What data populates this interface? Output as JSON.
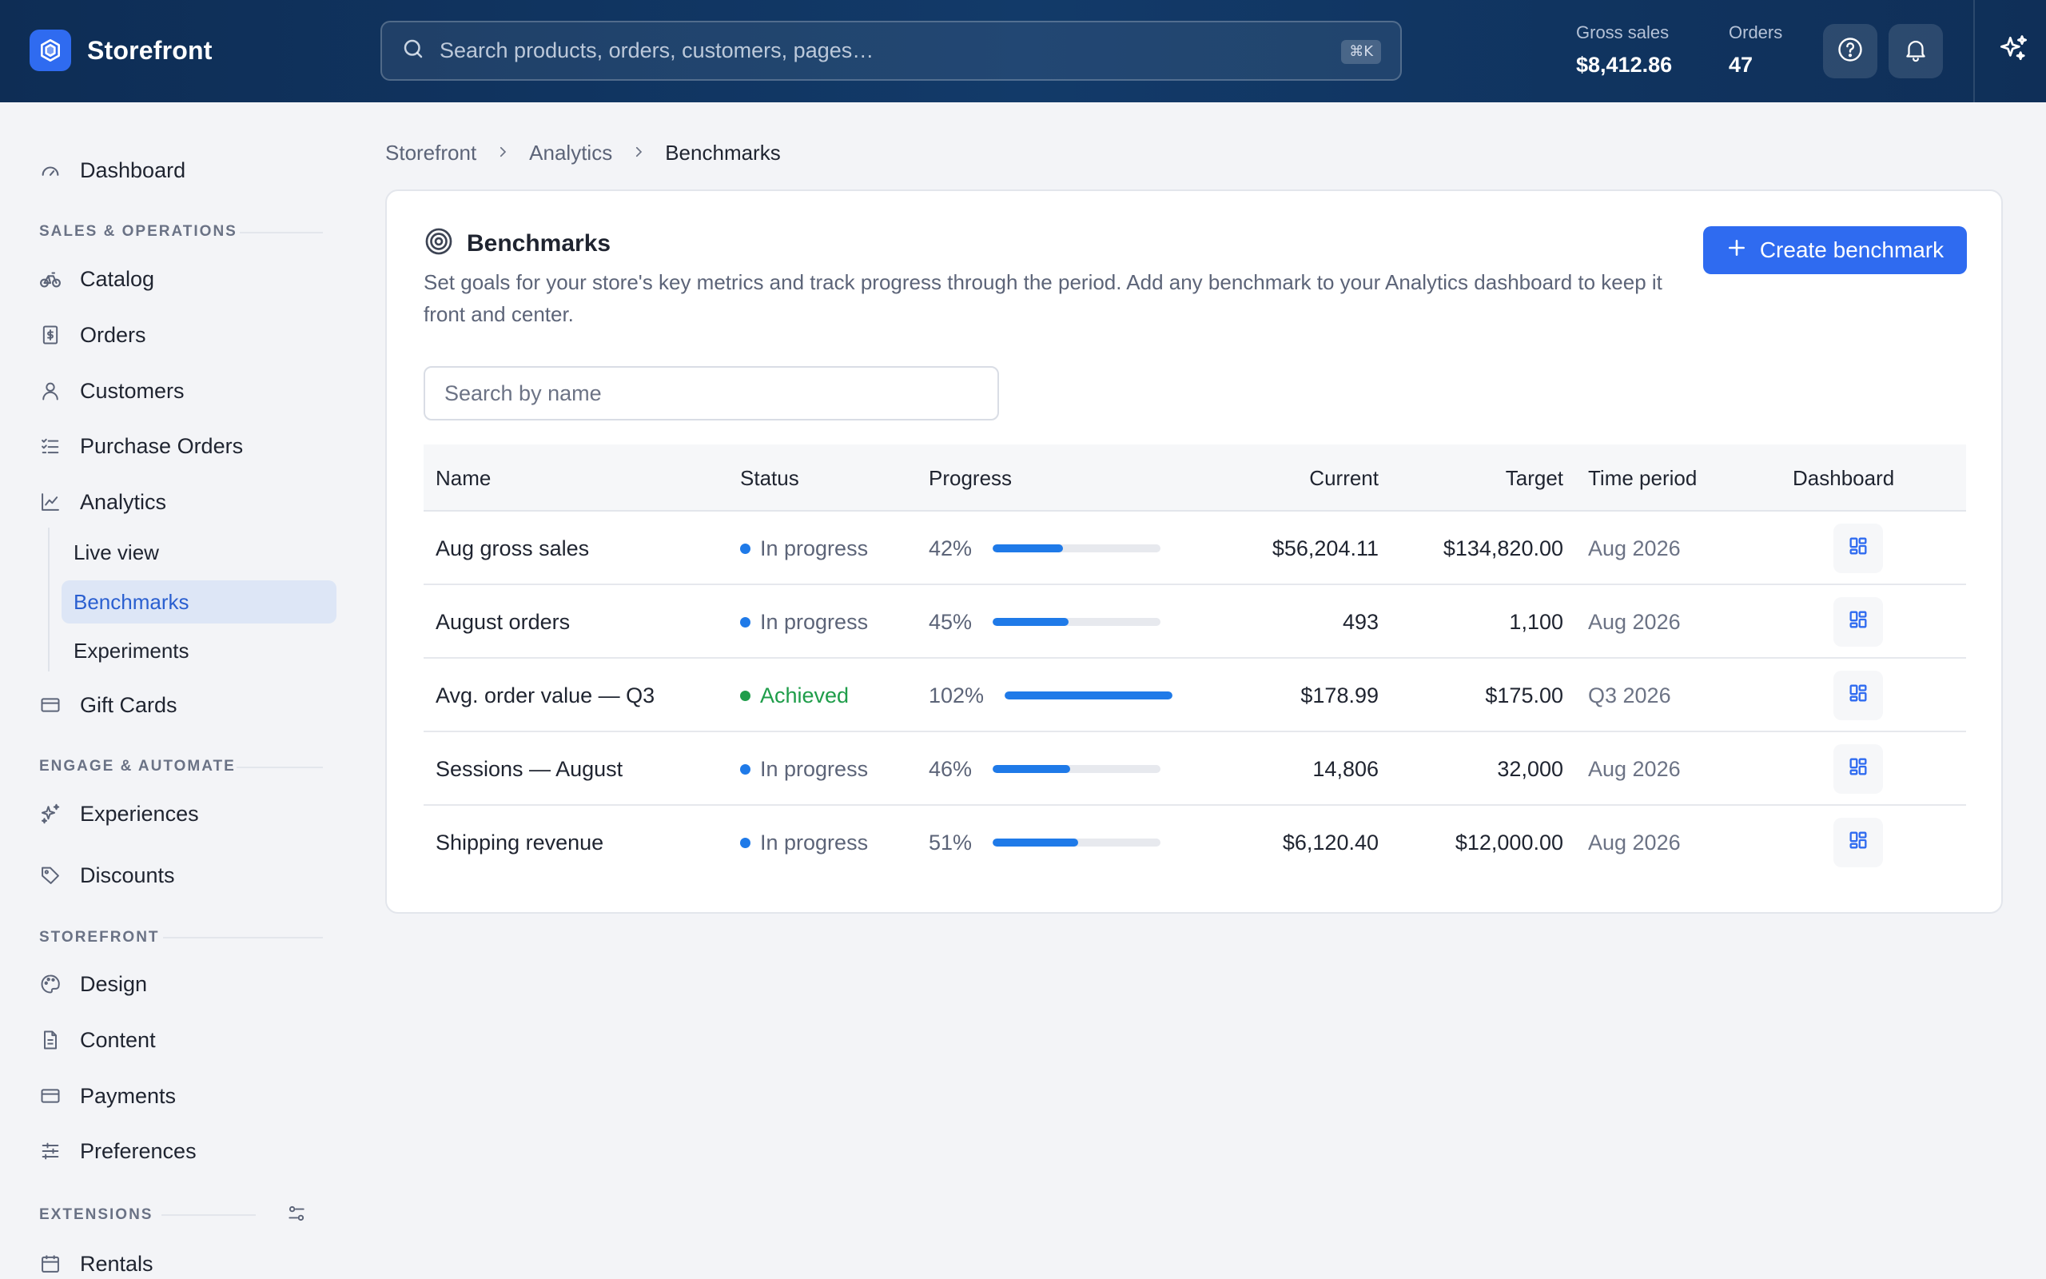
{
  "app": {
    "name": "Storefront"
  },
  "topbar": {
    "search_placeholder": "Search products, orders, customers, pages…",
    "shortcut": "⌘K",
    "gross_sales_label": "Gross sales",
    "gross_sales_value": "$8,412.86",
    "orders_label": "Orders",
    "orders_value": "47"
  },
  "sidebar": {
    "dashboard": "Dashboard",
    "sections": {
      "sales": "SALES & OPERATIONS",
      "engage": "ENGAGE & AUTOMATE",
      "storefront": "STOREFRONT",
      "extensions": "EXTENSIONS"
    },
    "items": {
      "catalog": "Catalog",
      "orders": "Orders",
      "customers": "Customers",
      "purchase_orders": "Purchase Orders",
      "analytics": "Analytics",
      "live_view": "Live view",
      "benchmarks": "Benchmarks",
      "experiments": "Experiments",
      "gift_cards": "Gift Cards",
      "experiences": "Experiences",
      "discounts": "Discounts",
      "design": "Design",
      "content": "Content",
      "payments": "Payments",
      "preferences": "Preferences",
      "rentals": "Rentals"
    }
  },
  "breadcrumb": [
    "Storefront",
    "Analytics",
    "Benchmarks"
  ],
  "page": {
    "title": "Benchmarks",
    "description": "Set goals for your store's key metrics and track progress through the period. Add any benchmark to your Analytics dashboard to keep it front and center.",
    "create_label": "Create benchmark",
    "search_placeholder": "Search by name"
  },
  "table": {
    "columns": {
      "name": "Name",
      "status": "Status",
      "progress": "Progress",
      "current": "Current",
      "target": "Target",
      "period": "Time period",
      "dashboard": "Dashboard"
    },
    "rows": [
      {
        "name": "Aug gross sales",
        "status": "In progress",
        "status_color": "#1f7ae8",
        "progress_label": "42%",
        "progress": 0.42,
        "current": "$56,204.11",
        "target": "$134,820.00",
        "period": "Aug 2026"
      },
      {
        "name": "August orders",
        "status": "In progress",
        "status_color": "#1f7ae8",
        "progress_label": "45%",
        "progress": 0.45,
        "current": "493",
        "target": "1,100",
        "period": "Aug 2026"
      },
      {
        "name": "Avg. order value — Q3",
        "status": "Achieved",
        "status_color": "#1f9d4a",
        "progress_label": "102%",
        "progress": 1.0,
        "current": "$178.99",
        "target": "$175.00",
        "period": "Q3 2026"
      },
      {
        "name": "Sessions — August",
        "status": "In progress",
        "status_color": "#1f7ae8",
        "progress_label": "46%",
        "progress": 0.46,
        "current": "14,806",
        "target": "32,000",
        "period": "Aug 2026"
      },
      {
        "name": "Shipping revenue",
        "status": "In progress",
        "status_color": "#1f7ae8",
        "progress_label": "51%",
        "progress": 0.51,
        "current": "$6,120.40",
        "target": "$12,000.00",
        "period": "Aug 2026"
      }
    ]
  },
  "colors": {
    "accent": "#2f6bf0",
    "topbar": "#123a69",
    "in_progress": "#1f7ae8",
    "achieved": "#1f9d4a"
  }
}
